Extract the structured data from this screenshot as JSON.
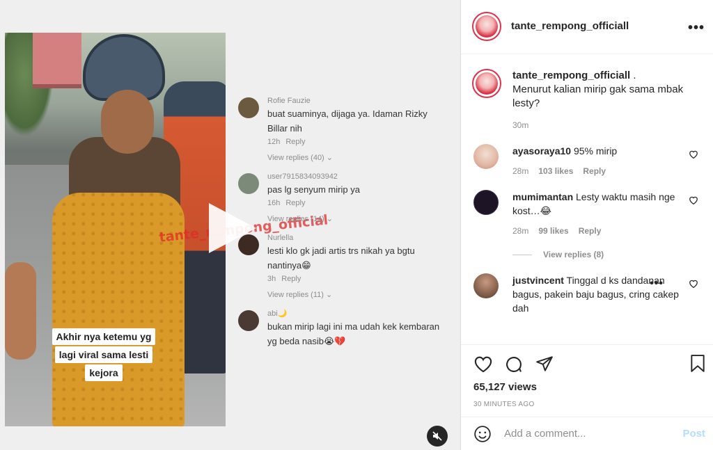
{
  "video": {
    "watermark": "tante_rempong_official",
    "caption_lines": [
      "Akhir nya ketemu yg",
      "lagi viral sama lesti",
      "kejora"
    ],
    "comments": [
      {
        "user": "Rofie Fauzie",
        "text": "buat suaminya, dijaga ya. Idaman Rizky Billar nih",
        "time": "12h",
        "reply": "Reply",
        "view_replies": "View replies (40)",
        "avatar_color": "#6b5a3f"
      },
      {
        "user": "user7915834093942",
        "text": "pas lg senyum mirip ya",
        "time": "16h",
        "reply": "Reply",
        "view_replies": "View replies (14)",
        "avatar_color": "#7c8a7a"
      },
      {
        "user": "Nurlella",
        "text": "lesti klo gk jadi artis trs nikah ya bgtu nantinya😁",
        "time": "3h",
        "reply": "Reply",
        "view_replies": "View replies (11)",
        "avatar_color": "#3d2a22"
      },
      {
        "user": "abi🌙",
        "text": "bukan mirip lagi ini ma udah kek kembaran yg beda nasib😭💔",
        "avatar_color": "#4a3a33"
      }
    ]
  },
  "header": {
    "handle": "tante_rempong_officiall",
    "more_label": "•••"
  },
  "caption": {
    "user": "tante_rempong_officiall",
    "suffix": " .",
    "text": "Menurut kalian mirip gak sama mbak lesty?",
    "time": "30m"
  },
  "comments": [
    {
      "user": "ayasoraya10",
      "text": " 95% mirip",
      "time": "28m",
      "likes": "103 likes",
      "reply": "Reply",
      "avatar_color": "#e8c7b8"
    },
    {
      "user": "mumimantan",
      "text": " Lesty waktu masih nge kost…😂",
      "time": "28m",
      "likes": "99 likes",
      "reply": "Reply",
      "view_replies": "View replies (8)",
      "avatar_color": "#1d1426"
    },
    {
      "user": "justvincent",
      "text": " Tinggal d ks dandanan bagus, pakein baju bagus, cring cakep dah",
      "avatar_color": "#7a5c4a",
      "more": "•••"
    }
  ],
  "stats": {
    "views": "65,127 views",
    "ago": "30 MINUTES AGO"
  },
  "composer": {
    "placeholder": "Add a comment...",
    "post_label": "Post"
  },
  "colors": {
    "accent_link": "#b2dffc",
    "brand_ring": "#e0314a",
    "text": "#262626",
    "muted": "#8e8e8e"
  }
}
